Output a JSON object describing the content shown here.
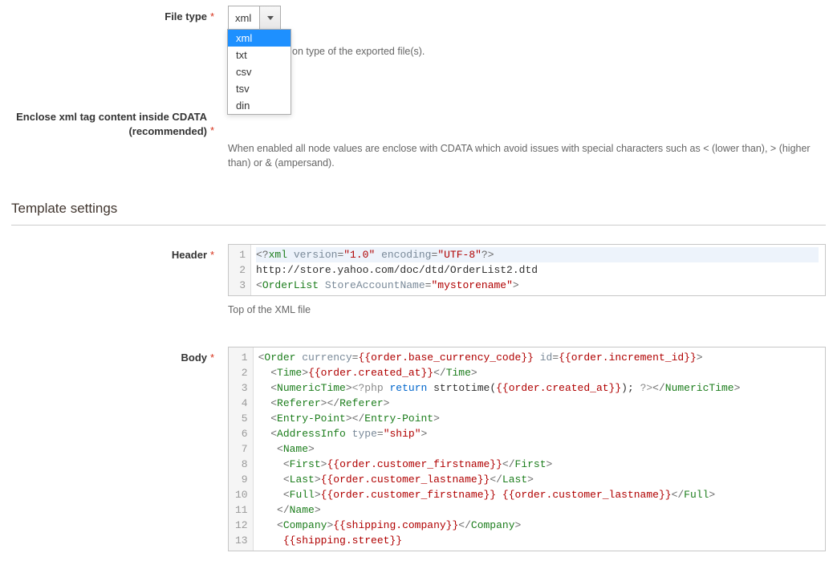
{
  "file_type": {
    "label": "File type",
    "selected": "xml",
    "options": [
      "xml",
      "txt",
      "csv",
      "tsv",
      "din"
    ],
    "help_tail": "on type of the exported file(s)."
  },
  "enclose_cdata": {
    "label": "Enclose xml tag content inside CDATA (recommended)",
    "help": "When enabled all node values are enclose with CDATA which avoid issues with special characters such as < (lower than), > (higher than) or & (ampersand)."
  },
  "template_settings": {
    "title": "Template settings"
  },
  "header_field": {
    "label": "Header",
    "help": "Top of the XML file",
    "code_lines": [
      {
        "n": 1,
        "segments": [
          {
            "cls": "punc",
            "t": "<?"
          },
          {
            "cls": "tag",
            "t": "xml"
          },
          {
            "cls": "",
            "t": " "
          },
          {
            "cls": "attr",
            "t": "version"
          },
          {
            "cls": "punc",
            "t": "="
          },
          {
            "cls": "str",
            "t": "\"1.0\""
          },
          {
            "cls": "",
            "t": " "
          },
          {
            "cls": "attr",
            "t": "encoding"
          },
          {
            "cls": "punc",
            "t": "="
          },
          {
            "cls": "str",
            "t": "\"UTF-8\""
          },
          {
            "cls": "punc",
            "t": "?>"
          }
        ],
        "hl": true
      },
      {
        "n": 2,
        "segments": [
          {
            "cls": "",
            "t": "http://store.yahoo.com/doc/dtd/OrderList2.dtd"
          }
        ]
      },
      {
        "n": 3,
        "segments": [
          {
            "cls": "punc",
            "t": "<"
          },
          {
            "cls": "tag",
            "t": "OrderList"
          },
          {
            "cls": "",
            "t": " "
          },
          {
            "cls": "attr",
            "t": "StoreAccountName"
          },
          {
            "cls": "punc",
            "t": "="
          },
          {
            "cls": "str",
            "t": "\"mystorename\""
          },
          {
            "cls": "punc",
            "t": ">"
          }
        ]
      }
    ]
  },
  "body_field": {
    "label": "Body",
    "code_lines": [
      {
        "n": 1,
        "segments": [
          {
            "cls": "punc",
            "t": "<"
          },
          {
            "cls": "tag",
            "t": "Order"
          },
          {
            "cls": "",
            "t": " "
          },
          {
            "cls": "attr",
            "t": "currency"
          },
          {
            "cls": "punc",
            "t": "="
          },
          {
            "cls": "var",
            "t": "{{order.base_currency_code}}"
          },
          {
            "cls": "",
            "t": " "
          },
          {
            "cls": "attr",
            "t": "id"
          },
          {
            "cls": "punc",
            "t": "="
          },
          {
            "cls": "var",
            "t": "{{order.increment_id}}"
          },
          {
            "cls": "punc",
            "t": ">"
          }
        ]
      },
      {
        "n": 2,
        "segments": [
          {
            "cls": "",
            "t": "  "
          },
          {
            "cls": "punc",
            "t": "<"
          },
          {
            "cls": "tag",
            "t": "Time"
          },
          {
            "cls": "punc",
            "t": ">"
          },
          {
            "cls": "var",
            "t": "{{order.created_at}}"
          },
          {
            "cls": "punc",
            "t": "</"
          },
          {
            "cls": "tag",
            "t": "Time"
          },
          {
            "cls": "punc",
            "t": ">"
          }
        ]
      },
      {
        "n": 3,
        "segments": [
          {
            "cls": "",
            "t": "  "
          },
          {
            "cls": "punc",
            "t": "<"
          },
          {
            "cls": "tag",
            "t": "NumericTime"
          },
          {
            "cls": "punc",
            "t": ">"
          },
          {
            "cls": "pi",
            "t": "<?php "
          },
          {
            "cls": "func",
            "t": "return"
          },
          {
            "cls": "",
            "t": " "
          },
          {
            "cls": "",
            "t": "strtotime("
          },
          {
            "cls": "var",
            "t": "{{order.created_at}}"
          },
          {
            "cls": "",
            "t": "); "
          },
          {
            "cls": "pi",
            "t": "?>"
          },
          {
            "cls": "punc",
            "t": "</"
          },
          {
            "cls": "tag",
            "t": "NumericTime"
          },
          {
            "cls": "punc",
            "t": ">"
          }
        ]
      },
      {
        "n": 4,
        "segments": [
          {
            "cls": "",
            "t": "  "
          },
          {
            "cls": "punc",
            "t": "<"
          },
          {
            "cls": "tag",
            "t": "Referer"
          },
          {
            "cls": "punc",
            "t": ">"
          },
          {
            "cls": "punc",
            "t": "</"
          },
          {
            "cls": "tag",
            "t": "Referer"
          },
          {
            "cls": "punc",
            "t": ">"
          }
        ]
      },
      {
        "n": 5,
        "segments": [
          {
            "cls": "",
            "t": "  "
          },
          {
            "cls": "punc",
            "t": "<"
          },
          {
            "cls": "tag",
            "t": "Entry-Point"
          },
          {
            "cls": "punc",
            "t": ">"
          },
          {
            "cls": "punc",
            "t": "</"
          },
          {
            "cls": "tag",
            "t": "Entry-Point"
          },
          {
            "cls": "punc",
            "t": ">"
          }
        ]
      },
      {
        "n": 6,
        "segments": [
          {
            "cls": "",
            "t": "  "
          },
          {
            "cls": "punc",
            "t": "<"
          },
          {
            "cls": "tag",
            "t": "AddressInfo"
          },
          {
            "cls": "",
            "t": " "
          },
          {
            "cls": "attr",
            "t": "type"
          },
          {
            "cls": "punc",
            "t": "="
          },
          {
            "cls": "str",
            "t": "\"ship\""
          },
          {
            "cls": "punc",
            "t": ">"
          }
        ]
      },
      {
        "n": 7,
        "segments": [
          {
            "cls": "",
            "t": "   "
          },
          {
            "cls": "punc",
            "t": "<"
          },
          {
            "cls": "tag",
            "t": "Name"
          },
          {
            "cls": "punc",
            "t": ">"
          }
        ]
      },
      {
        "n": 8,
        "segments": [
          {
            "cls": "",
            "t": "    "
          },
          {
            "cls": "punc",
            "t": "<"
          },
          {
            "cls": "tag",
            "t": "First"
          },
          {
            "cls": "punc",
            "t": ">"
          },
          {
            "cls": "var",
            "t": "{{order.customer_firstname}}"
          },
          {
            "cls": "punc",
            "t": "</"
          },
          {
            "cls": "tag",
            "t": "First"
          },
          {
            "cls": "punc",
            "t": ">"
          }
        ]
      },
      {
        "n": 9,
        "segments": [
          {
            "cls": "",
            "t": "    "
          },
          {
            "cls": "punc",
            "t": "<"
          },
          {
            "cls": "tag",
            "t": "Last"
          },
          {
            "cls": "punc",
            "t": ">"
          },
          {
            "cls": "var",
            "t": "{{order.customer_lastname}}"
          },
          {
            "cls": "punc",
            "t": "</"
          },
          {
            "cls": "tag",
            "t": "Last"
          },
          {
            "cls": "punc",
            "t": ">"
          }
        ]
      },
      {
        "n": 10,
        "segments": [
          {
            "cls": "",
            "t": "    "
          },
          {
            "cls": "punc",
            "t": "<"
          },
          {
            "cls": "tag",
            "t": "Full"
          },
          {
            "cls": "punc",
            "t": ">"
          },
          {
            "cls": "var",
            "t": "{{order.customer_firstname}}"
          },
          {
            "cls": "",
            "t": " "
          },
          {
            "cls": "var",
            "t": "{{order.customer_lastname}}"
          },
          {
            "cls": "punc",
            "t": "</"
          },
          {
            "cls": "tag",
            "t": "Full"
          },
          {
            "cls": "punc",
            "t": ">"
          }
        ]
      },
      {
        "n": 11,
        "segments": [
          {
            "cls": "",
            "t": "   "
          },
          {
            "cls": "punc",
            "t": "</"
          },
          {
            "cls": "tag",
            "t": "Name"
          },
          {
            "cls": "punc",
            "t": ">"
          }
        ]
      },
      {
        "n": 12,
        "segments": [
          {
            "cls": "",
            "t": "   "
          },
          {
            "cls": "punc",
            "t": "<"
          },
          {
            "cls": "tag",
            "t": "Company"
          },
          {
            "cls": "punc",
            "t": ">"
          },
          {
            "cls": "var",
            "t": "{{shipping.company}}"
          },
          {
            "cls": "punc",
            "t": "</"
          },
          {
            "cls": "tag",
            "t": "Company"
          },
          {
            "cls": "punc",
            "t": ">"
          }
        ]
      },
      {
        "n": 13,
        "segments": [
          {
            "cls": "",
            "t": "    "
          },
          {
            "cls": "var",
            "t": "{{shipping.street}}"
          }
        ]
      }
    ]
  }
}
